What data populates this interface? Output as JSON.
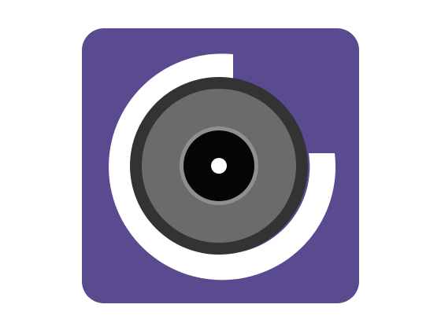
{
  "icon": {
    "name": "camera-lens-g-logo-icon",
    "colors": {
      "background": "#ffffff",
      "tile": "#5a4a8f",
      "ring": "#ffffff",
      "lens_outer": "#333333",
      "lens_mid": "#6b6b6b",
      "lens_inner_ring": "#8f8f8f",
      "pupil": "#050505",
      "highlight": "#ffffff"
    }
  }
}
